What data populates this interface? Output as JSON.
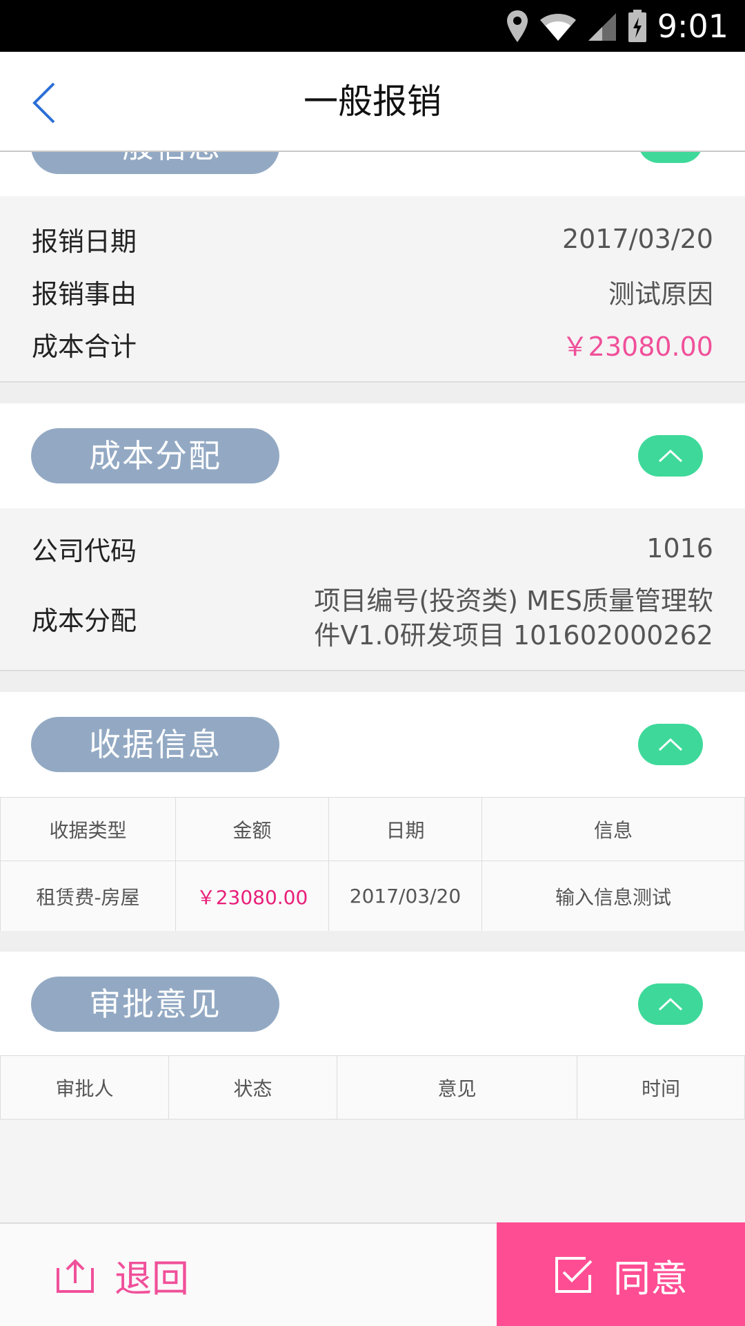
{
  "status_bar": {
    "time": "9:01",
    "icons": [
      "location-icon",
      "wifi-icon",
      "signal-icon",
      "battery-charging-icon"
    ]
  },
  "header": {
    "title": "一般报销",
    "back_icon": "chevron-left-icon"
  },
  "general_info": {
    "section_label": "一般信息",
    "rows": [
      {
        "label": "报销日期",
        "value": "2017/03/20"
      },
      {
        "label": "报销事由",
        "value": "测试原因"
      },
      {
        "label": "成本合计",
        "value": "￥23080.00"
      }
    ]
  },
  "cost_allocation": {
    "section_label": "成本分配",
    "company_code_label": "公司代码",
    "company_code_value": "1016",
    "allocation_label": "成本分配",
    "allocation_value_line1": "项目编号(投资类)  MES质量管理软",
    "allocation_value_line2": "件V1.0研发项目  101602000262"
  },
  "receipt_info": {
    "section_label": "收据信息",
    "columns": [
      "收据类型",
      "金额",
      "日期",
      "信息"
    ],
    "rows": [
      {
        "type": "租赁费-房屋",
        "amount": "￥23080.00",
        "date": "2017/03/20",
        "info": "输入信息测试"
      }
    ]
  },
  "approval": {
    "section_label": "审批意见",
    "columns": [
      "审批人",
      "状态",
      "意见",
      "时间"
    ]
  },
  "actions": {
    "return_label": "退回",
    "agree_label": "同意"
  },
  "colors": {
    "accent_pink": "#ff4d93",
    "amount_pink": "#f0509a",
    "toggle_green": "#3ed99a",
    "pill_blue_gray": "#93a9c3",
    "back_blue": "#2b6fd6"
  }
}
